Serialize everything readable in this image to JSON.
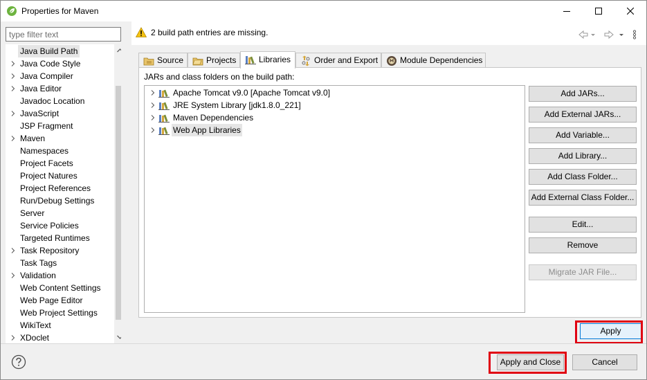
{
  "window": {
    "title": "Properties for Maven"
  },
  "filter": {
    "placeholder": "type filter text"
  },
  "nav": {
    "items": [
      {
        "label": "Java Build Path",
        "expandable": false,
        "selected": true
      },
      {
        "label": "Java Code Style",
        "expandable": true
      },
      {
        "label": "Java Compiler",
        "expandable": true
      },
      {
        "label": "Java Editor",
        "expandable": true
      },
      {
        "label": "Javadoc Location",
        "expandable": false
      },
      {
        "label": "JavaScript",
        "expandable": true
      },
      {
        "label": "JSP Fragment",
        "expandable": false
      },
      {
        "label": "Maven",
        "expandable": true
      },
      {
        "label": "Namespaces",
        "expandable": false
      },
      {
        "label": "Project Facets",
        "expandable": false
      },
      {
        "label": "Project Natures",
        "expandable": false
      },
      {
        "label": "Project References",
        "expandable": false
      },
      {
        "label": "Run/Debug Settings",
        "expandable": false
      },
      {
        "label": "Server",
        "expandable": false
      },
      {
        "label": "Service Policies",
        "expandable": false
      },
      {
        "label": "Targeted Runtimes",
        "expandable": false
      },
      {
        "label": "Task Repository",
        "expandable": true
      },
      {
        "label": "Task Tags",
        "expandable": false
      },
      {
        "label": "Validation",
        "expandable": true
      },
      {
        "label": "Web Content Settings",
        "expandable": false
      },
      {
        "label": "Web Page Editor",
        "expandable": false
      },
      {
        "label": "Web Project Settings",
        "expandable": false
      },
      {
        "label": "WikiText",
        "expandable": false
      },
      {
        "label": "XDoclet",
        "expandable": true
      }
    ]
  },
  "message": {
    "text": "2 build path entries are missing.",
    "icon": "warning-icon"
  },
  "tabs": [
    {
      "label": "Source",
      "icon": "source-folder-icon"
    },
    {
      "label": "Projects",
      "icon": "projects-folder-icon"
    },
    {
      "label": "Libraries",
      "icon": "libraries-icon",
      "active": true
    },
    {
      "label": "Order and Export",
      "icon": "order-export-icon"
    },
    {
      "label": "Module Dependencies",
      "icon": "module-dependencies-icon"
    }
  ],
  "libraries": {
    "heading": "JARs and class folders on the build path:",
    "items": [
      {
        "label": "Apache Tomcat v9.0 [Apache Tomcat v9.0]"
      },
      {
        "label": "JRE System Library [jdk1.8.0_221]"
      },
      {
        "label": "Maven Dependencies"
      },
      {
        "label": "Web App Libraries",
        "selected": true
      }
    ]
  },
  "side_buttons": {
    "add_jars": "Add JARs...",
    "add_external_jars": "Add External JARs...",
    "add_variable": "Add Variable...",
    "add_library": "Add Library...",
    "add_class_folder": "Add Class Folder...",
    "add_external_class_folder": "Add External Class Folder...",
    "edit": "Edit...",
    "remove": "Remove",
    "migrate_jar": "Migrate JAR File..."
  },
  "footer": {
    "apply": "Apply",
    "apply_and_close": "Apply and Close",
    "cancel": "Cancel"
  },
  "colors": {
    "highlight_box": "#e00012",
    "focus_blue": "#0078d7"
  }
}
